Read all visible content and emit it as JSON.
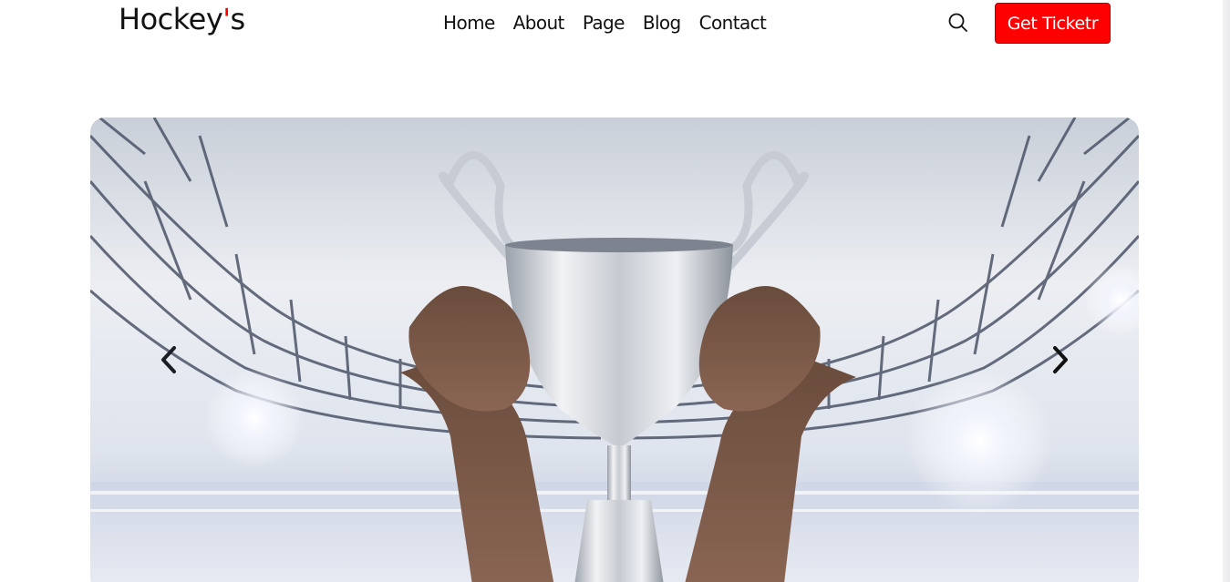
{
  "brand": {
    "name_main": "Hockey",
    "name_apos": "'",
    "name_end": "s",
    "accent": "#ff0000"
  },
  "nav": {
    "items": [
      {
        "label": "Home"
      },
      {
        "label": "About"
      },
      {
        "label": "Page"
      },
      {
        "label": "Blog"
      },
      {
        "label": "Contact"
      }
    ]
  },
  "header_actions": {
    "search_icon": "search-icon",
    "cta_label": "Get Ticketr"
  },
  "hero": {
    "image_subject": "hands holding silver trophy in stadium",
    "prev_icon": "chevron-left-icon",
    "next_icon": "chevron-right-icon"
  }
}
